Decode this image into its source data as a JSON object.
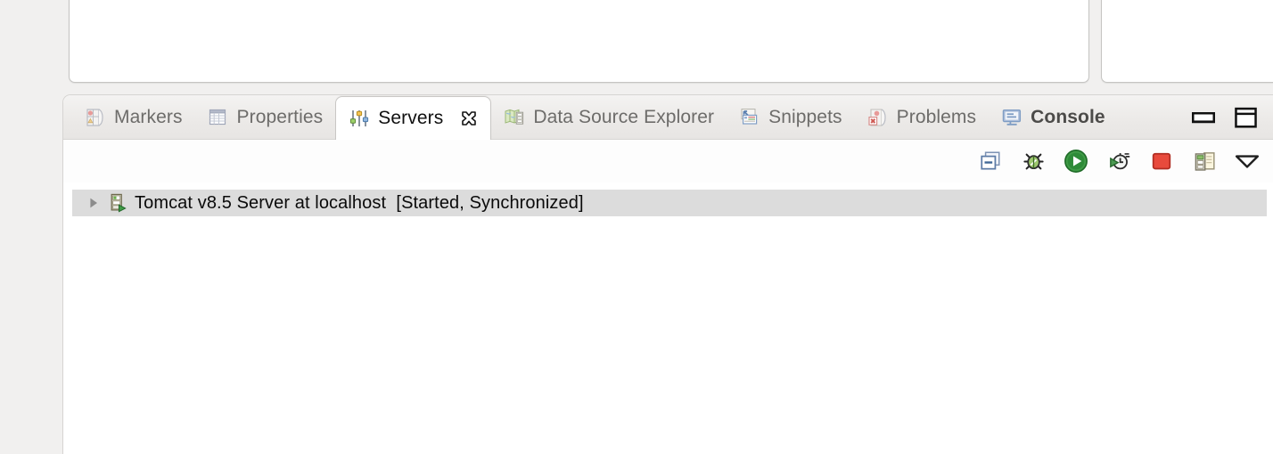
{
  "window": {
    "app": "Eclipse IDE",
    "editor_area_note": ""
  },
  "view_stack": {
    "tabs": [
      {
        "label": "Markers",
        "icon": "markers-icon",
        "active": false,
        "bold": false,
        "closable": false
      },
      {
        "label": "Properties",
        "icon": "properties-table-icon",
        "active": false,
        "bold": false,
        "closable": false
      },
      {
        "label": "Servers",
        "icon": "servers-sliders-icon",
        "active": true,
        "bold": false,
        "closable": true
      },
      {
        "label": "Data Source Explorer",
        "icon": "data-source-explorer-icon",
        "active": false,
        "bold": false,
        "closable": false
      },
      {
        "label": "Snippets",
        "icon": "snippets-icon",
        "active": false,
        "bold": false,
        "closable": false
      },
      {
        "label": "Problems",
        "icon": "problems-icon",
        "active": false,
        "bold": false,
        "closable": false
      },
      {
        "label": "Console",
        "icon": "console-monitor-icon",
        "active": false,
        "bold": true,
        "closable": false
      }
    ],
    "window_buttons": [
      {
        "name": "minimize-button",
        "icon": "minimize-icon",
        "tooltip": "Minimize"
      },
      {
        "name": "maximize-button",
        "icon": "maximize-icon",
        "tooltip": "Maximize"
      }
    ]
  },
  "servers_view": {
    "toolbar": [
      {
        "name": "new-server-button",
        "icon": "new-server-icon",
        "tooltip": "New Server"
      },
      {
        "name": "debug-button",
        "icon": "debug-bug-icon",
        "tooltip": "Start the server in debug mode"
      },
      {
        "name": "start-button",
        "icon": "start-play-icon",
        "tooltip": "Start the server"
      },
      {
        "name": "profile-button",
        "icon": "profile-clock-icon",
        "tooltip": "Start the server in profiling mode"
      },
      {
        "name": "stop-button",
        "icon": "stop-square-icon",
        "tooltip": "Stop the server"
      },
      {
        "name": "publish-button",
        "icon": "publish-icon",
        "tooltip": "Publish to the server"
      },
      {
        "name": "view-menu-button",
        "icon": "view-menu-chevron-icon",
        "tooltip": "View Menu"
      }
    ],
    "rows": [
      {
        "expanded": false,
        "icon": "tomcat-server-icon",
        "name": "Tomcat v8.5 Server at localhost",
        "status": "[Started, Synchronized]",
        "full_text": "Tomcat v8.5 Server at localhost  [Started, Synchronized]",
        "selected": true
      }
    ]
  },
  "colors": {
    "panel_background": "#f1f0ef",
    "tab_active_background": "#ffffff",
    "tab_label": "#6d6c6a",
    "tab_active_label": "#101010",
    "selection_row": "#dcdcdc",
    "start_green": "#2e9b3c",
    "stop_red": "#e03b30",
    "console_blue": "#8aa4cc",
    "view_background": "#ffffff"
  }
}
